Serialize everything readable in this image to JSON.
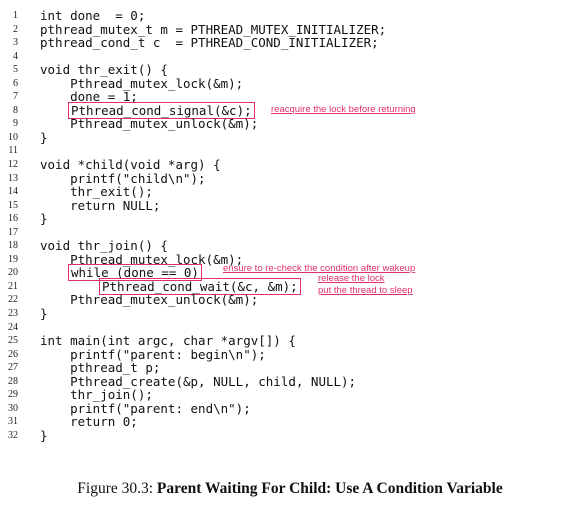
{
  "lines": [
    {
      "n": "1",
      "code": "int done  = 0;"
    },
    {
      "n": "2",
      "code": "pthread_mutex_t m = PTHREAD_MUTEX_INITIALIZER;"
    },
    {
      "n": "3",
      "code": "pthread_cond_t c  = PTHREAD_COND_INITIALIZER;"
    },
    {
      "n": "4",
      "code": ""
    },
    {
      "n": "5",
      "code": "void thr_exit() {"
    },
    {
      "n": "6",
      "code": "    Pthread_mutex_lock(&m);"
    },
    {
      "n": "7",
      "code": "    done = 1;"
    },
    {
      "n": "8",
      "code": "Pthread_cond_signal(&c);"
    },
    {
      "n": "9",
      "code": "    Pthread_mutex_unlock(&m);"
    },
    {
      "n": "10",
      "code": "}"
    },
    {
      "n": "11",
      "code": ""
    },
    {
      "n": "12",
      "code": "void *child(void *arg) {"
    },
    {
      "n": "13",
      "code": "    printf(\"child\\n\");"
    },
    {
      "n": "14",
      "code": "    thr_exit();"
    },
    {
      "n": "15",
      "code": "    return NULL;"
    },
    {
      "n": "16",
      "code": "}"
    },
    {
      "n": "17",
      "code": ""
    },
    {
      "n": "18",
      "code": "void thr_join() {"
    },
    {
      "n": "19",
      "code": "    Pthread_mutex_lock(&m);"
    },
    {
      "n": "20",
      "code": "while (done == 0)"
    },
    {
      "n": "21",
      "code": "Pthread_cond_wait(&c, &m);"
    },
    {
      "n": "22",
      "code": "    Pthread_mutex_unlock(&m);"
    },
    {
      "n": "23",
      "code": "}"
    },
    {
      "n": "24",
      "code": ""
    },
    {
      "n": "25",
      "code": "int main(int argc, char *argv[]) {"
    },
    {
      "n": "26",
      "code": "    printf(\"parent: begin\\n\");"
    },
    {
      "n": "27",
      "code": "    pthread_t p;"
    },
    {
      "n": "28",
      "code": "    Pthread_create(&p, NULL, child, NULL);"
    },
    {
      "n": "29",
      "code": "    thr_join();"
    },
    {
      "n": "30",
      "code": "    printf(\"parent: end\\n\");"
    },
    {
      "n": "31",
      "code": "    return 0;"
    },
    {
      "n": "32",
      "code": "}"
    }
  ],
  "annotations": {
    "reacquire": "reacquire the lock before returning",
    "recheck": "ensure to re-check the condition after wakeup",
    "release": "release the lock",
    "sleep": "put the thread to sleep"
  },
  "caption": {
    "prefix": "Figure 30.3: ",
    "title": "Parent Waiting For Child: Use A Condition Variable"
  },
  "colors": {
    "highlight": "#e0306a"
  }
}
